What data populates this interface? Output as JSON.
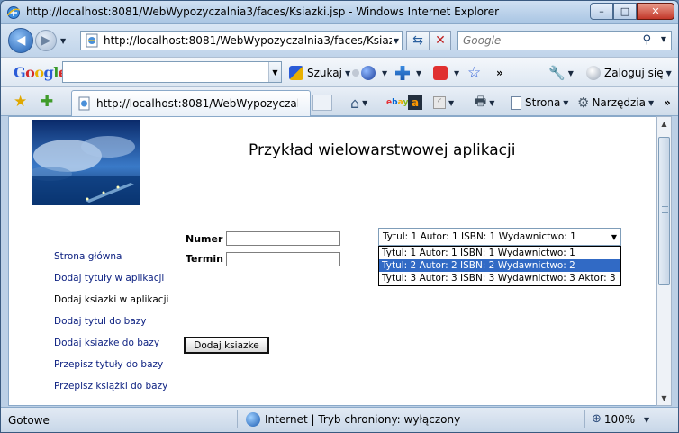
{
  "window": {
    "title": "http://localhost:8081/WebWypozyczalnia3/faces/Ksiazki.jsp - Windows Internet Explorer",
    "buttons": {
      "minimize": "–",
      "maximize": "□",
      "close": "✕"
    }
  },
  "addressbar": {
    "url": "http://localhost:8081/WebWypozyczalnia3/faces/Ksiazki.jsp",
    "search_placeholder": "Google"
  },
  "google_toolbar": {
    "logo": "Google",
    "search_value": "",
    "search_button": "Szukaj",
    "more": "»",
    "signin": "Zaloguj się"
  },
  "tabs": [
    {
      "label": "http://localhost:8081/WebWypozyczalnia3..."
    }
  ],
  "command_bar": {
    "page_menu": "Strona",
    "tools_menu": "Narzędzia",
    "more": "»"
  },
  "page": {
    "heading": "Przykład wielowarstwowej aplikacji",
    "nav": [
      {
        "label": "Strona główna",
        "current": false
      },
      {
        "label": "Dodaj tytuły w aplikacji",
        "current": false
      },
      {
        "label": "Dodaj ksiazki w aplikacji",
        "current": true
      },
      {
        "label": "Dodaj tytul do bazy",
        "current": false
      },
      {
        "label": "Dodaj ksiazke do bazy",
        "current": false
      },
      {
        "label": "Przepisz tytuły do bazy",
        "current": false
      },
      {
        "label": "Przepisz książki do bazy",
        "current": false
      }
    ],
    "form": {
      "numer_label": "Numer",
      "numer_value": "",
      "termin_label": "Termin",
      "termin_value": "",
      "submit_label": "Dodaj ksiazke"
    },
    "select": {
      "value": "Tytul: 1 Autor: 1 ISBN: 1 Wydawnictwo: 1",
      "options": [
        "Tytul: 1 Autor: 1 ISBN: 1 Wydawnictwo: 1",
        "Tytul: 2 Autor: 2 ISBN: 2 Wydawnictwo: 2",
        "Tytul: 3 Autor: 3 ISBN: 3 Wydawnictwo: 3 Aktor: 3"
      ],
      "highlighted_index": 1
    }
  },
  "statusbar": {
    "status": "Gotowe",
    "zone": "Internet | Tryb chroniony: wyłączony",
    "zoom": "100%"
  },
  "colors": {
    "link": "#0b1f80",
    "selection": "#316ac5",
    "chrome": "#bcd0e6"
  }
}
